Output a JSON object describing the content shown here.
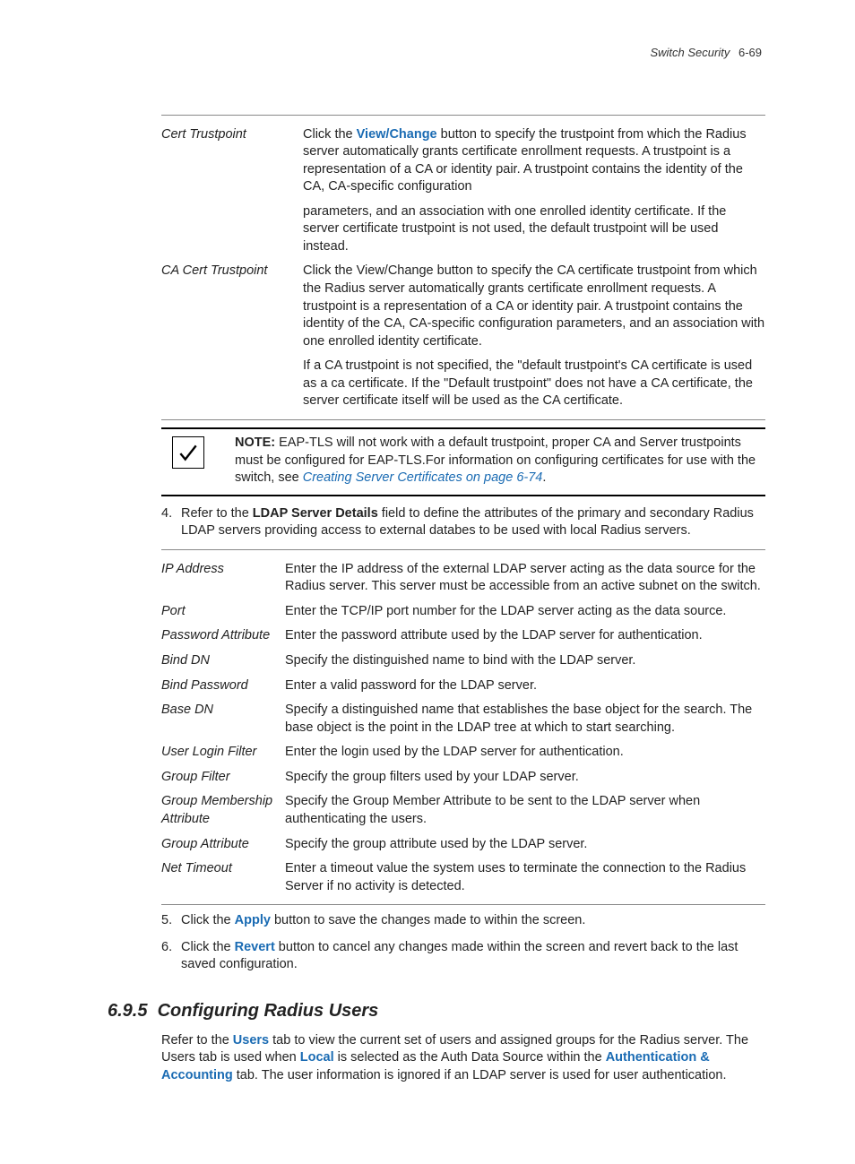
{
  "header": {
    "chapter_name": "Switch Security",
    "page_ref": "6-69"
  },
  "table1": {
    "rows": [
      {
        "term": "Cert Trustpoint",
        "paras": [
          {
            "segments": [
              {
                "t": "Click the "
              },
              {
                "t": "View/Change",
                "cls": "bold-link"
              },
              {
                "t": " button to specify the trustpoint from which the Radius server automatically grants certificate enrollment requests. A trustpoint is a representation of a CA or identity pair. A trustpoint contains the identity of the CA, CA-specific configuration"
              }
            ]
          },
          {
            "segments": [
              {
                "t": "parameters, and an association with one enrolled identity certificate. If the server certificate trustpoint is not used, the default trustpoint will be used instead."
              }
            ]
          }
        ]
      },
      {
        "term": "CA Cert Trustpoint",
        "paras": [
          {
            "segments": [
              {
                "t": "Click the View/Change button to specify the CA certificate trustpoint from which the Radius server automatically grants certificate enrollment requests. A trustpoint is a representation of a CA or identity pair. A trustpoint contains the identity of the CA, CA-specific configuration parameters, and an association with one enrolled identity certificate."
              }
            ]
          },
          {
            "segments": [
              {
                "t": "If a CA trustpoint is not specified, the \"default trustpoint's CA certificate is used as a ca certificate. If the \"Default trustpoint\" does not have a CA certificate, the server certificate itself will be used as the CA certificate."
              }
            ]
          }
        ]
      }
    ]
  },
  "note": {
    "label": "NOTE:",
    "body_pre": " EAP-TLS will not work with a default trustpoint, proper CA and Server trustpoints must be configured for EAP-TLS.For information on configuring certificates for use with the switch, see ",
    "link": "Creating Server Certificates on page 6-74",
    "body_post": "."
  },
  "step4": {
    "num": "4.",
    "pre": "Refer to the ",
    "bold": "LDAP Server Details",
    "post": " field to define the attributes of the primary and secondary Radius LDAP servers providing access to external databes to be used with local Radius servers."
  },
  "table2": {
    "rows": [
      {
        "term": "IP Address",
        "desc": "Enter the IP address of the external LDAP server acting as the data source for the Radius server. This server must be accessible from an active subnet on the switch."
      },
      {
        "term": "Port",
        "desc": "Enter the TCP/IP port number for the LDAP server acting as the data source."
      },
      {
        "term": "Password Attribute",
        "desc": "Enter the password attribute used by the LDAP server for authentication."
      },
      {
        "term": "Bind DN",
        "desc": "Specify the distinguished name to bind with the LDAP server."
      },
      {
        "term": "Bind Password",
        "desc": "Enter a valid password for the LDAP server."
      },
      {
        "term": "Base DN",
        "desc": "Specify a distinguished name that establishes the base object for the search. The base object is the point in the LDAP tree at which to start searching."
      },
      {
        "term": "User Login Filter",
        "desc": "Enter the login used by the LDAP server for authentication."
      },
      {
        "term": "Group Filter",
        "desc": "Specify the group filters used by your LDAP server."
      },
      {
        "term": "Group Membership Attribute",
        "desc": "Specify the Group Member Attribute to be sent to the LDAP server when authenticating the users."
      },
      {
        "term": "Group Attribute",
        "desc": "Specify the group attribute used by the LDAP server."
      },
      {
        "term": "Net Timeout",
        "desc": "Enter a timeout value the system uses to terminate the connection to the Radius Server if no activity is detected."
      }
    ]
  },
  "step5": {
    "num": "5.",
    "pre": "Click the ",
    "bold": "Apply",
    "post": " button to save the changes made to within the screen."
  },
  "step6": {
    "num": "6.",
    "pre": "Click the ",
    "bold": "Revert",
    "post": " button to cancel any changes made within the screen and revert back to the last saved configuration."
  },
  "section": {
    "number": "6.9.5",
    "title": "Configuring Radius Users",
    "body_segments": [
      {
        "t": "Refer to the "
      },
      {
        "t": "Users",
        "cls": "bold-link"
      },
      {
        "t": " tab to view the current set of users and assigned groups for the Radius server. The Users tab is used when "
      },
      {
        "t": "Local",
        "cls": "bold-link"
      },
      {
        "t": " is selected as the Auth Data Source within the "
      },
      {
        "t": "Authentication & Accounting",
        "cls": "bold-link"
      },
      {
        "t": " tab. The user information is ignored if an LDAP server is used for user authentication."
      }
    ]
  }
}
